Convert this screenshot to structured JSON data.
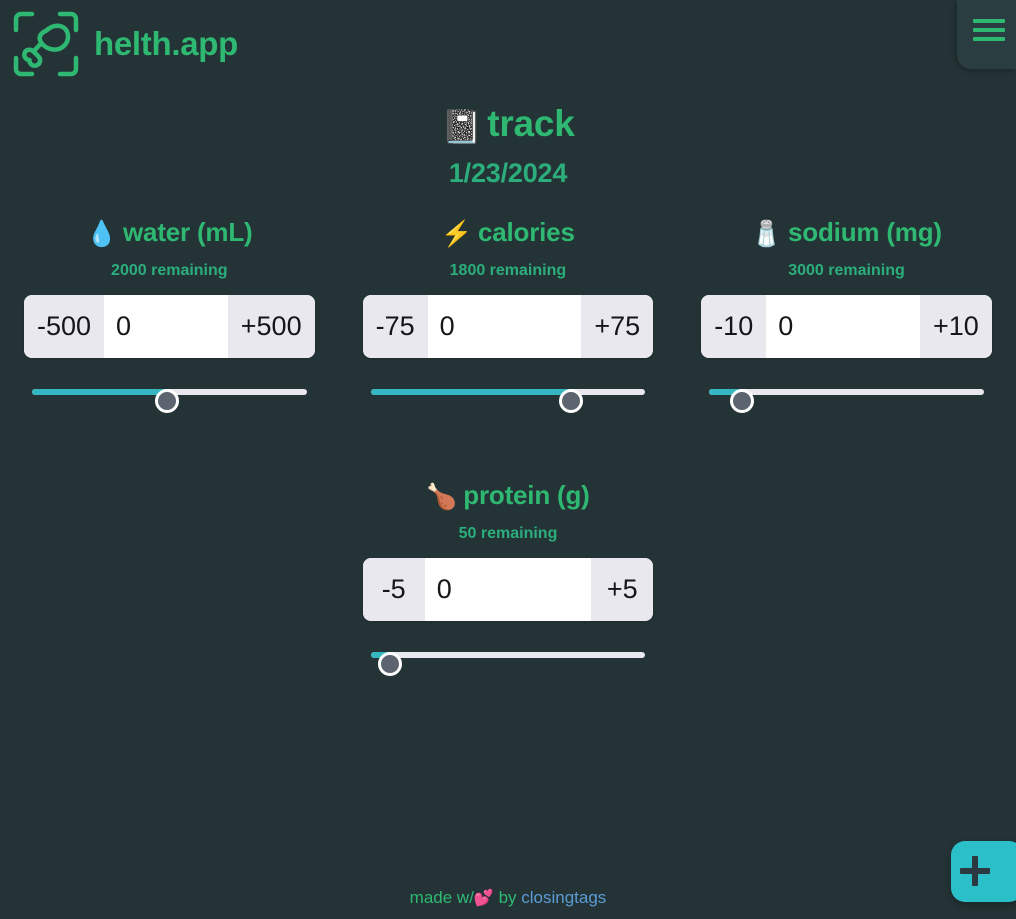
{
  "brand": {
    "name": "helth.app",
    "logo_icon": "drumstick-scan-logo"
  },
  "menu": {
    "icon": "hamburger-menu-icon",
    "label": "menu"
  },
  "header": {
    "title": "track",
    "title_emoji": "📓",
    "date": "1/23/2024"
  },
  "metrics": [
    {
      "key": "water",
      "emoji": "💧",
      "icon_name": "water-drop-icon",
      "title": "water (mL)",
      "remaining": "2000 remaining",
      "decrement_label": "-500",
      "increment_label": "+500",
      "value": "0",
      "placeholder": "0",
      "slider_percent": 49
    },
    {
      "key": "calories",
      "emoji": "⚡",
      "icon_name": "lightning-bolt-icon",
      "title": "calories",
      "remaining": "1800 remaining",
      "decrement_label": "-75",
      "increment_label": "+75",
      "value": "0",
      "placeholder": "0",
      "slider_percent": 73
    },
    {
      "key": "sodium",
      "emoji": "🧂",
      "icon_name": "salt-shaker-icon",
      "title": "sodium (mg)",
      "remaining": "3000 remaining",
      "decrement_label": "-10",
      "increment_label": "+10",
      "value": "0",
      "placeholder": "0",
      "slider_percent": 12
    },
    {
      "key": "protein",
      "emoji": "🍗",
      "icon_name": "poultry-leg-icon",
      "title": "protein (g)",
      "remaining": "50 remaining",
      "decrement_label": "-5",
      "increment_label": "+5",
      "value": "0",
      "placeholder": "0",
      "slider_percent": 7
    }
  ],
  "footer": {
    "prefix": "made w/",
    "heart": "💕",
    "middle": " by ",
    "link": "closingtags"
  },
  "fab": {
    "icon": "plus-icon",
    "label": "add entry"
  },
  "colors": {
    "background": "#243436",
    "accent_green": "#2eb872",
    "accent_teal": "#35b6c0",
    "fab_teal": "#2bbfca",
    "link_blue": "#5b9bd5",
    "control_gray": "#e9e8ee",
    "panel": "#2a3d40"
  }
}
